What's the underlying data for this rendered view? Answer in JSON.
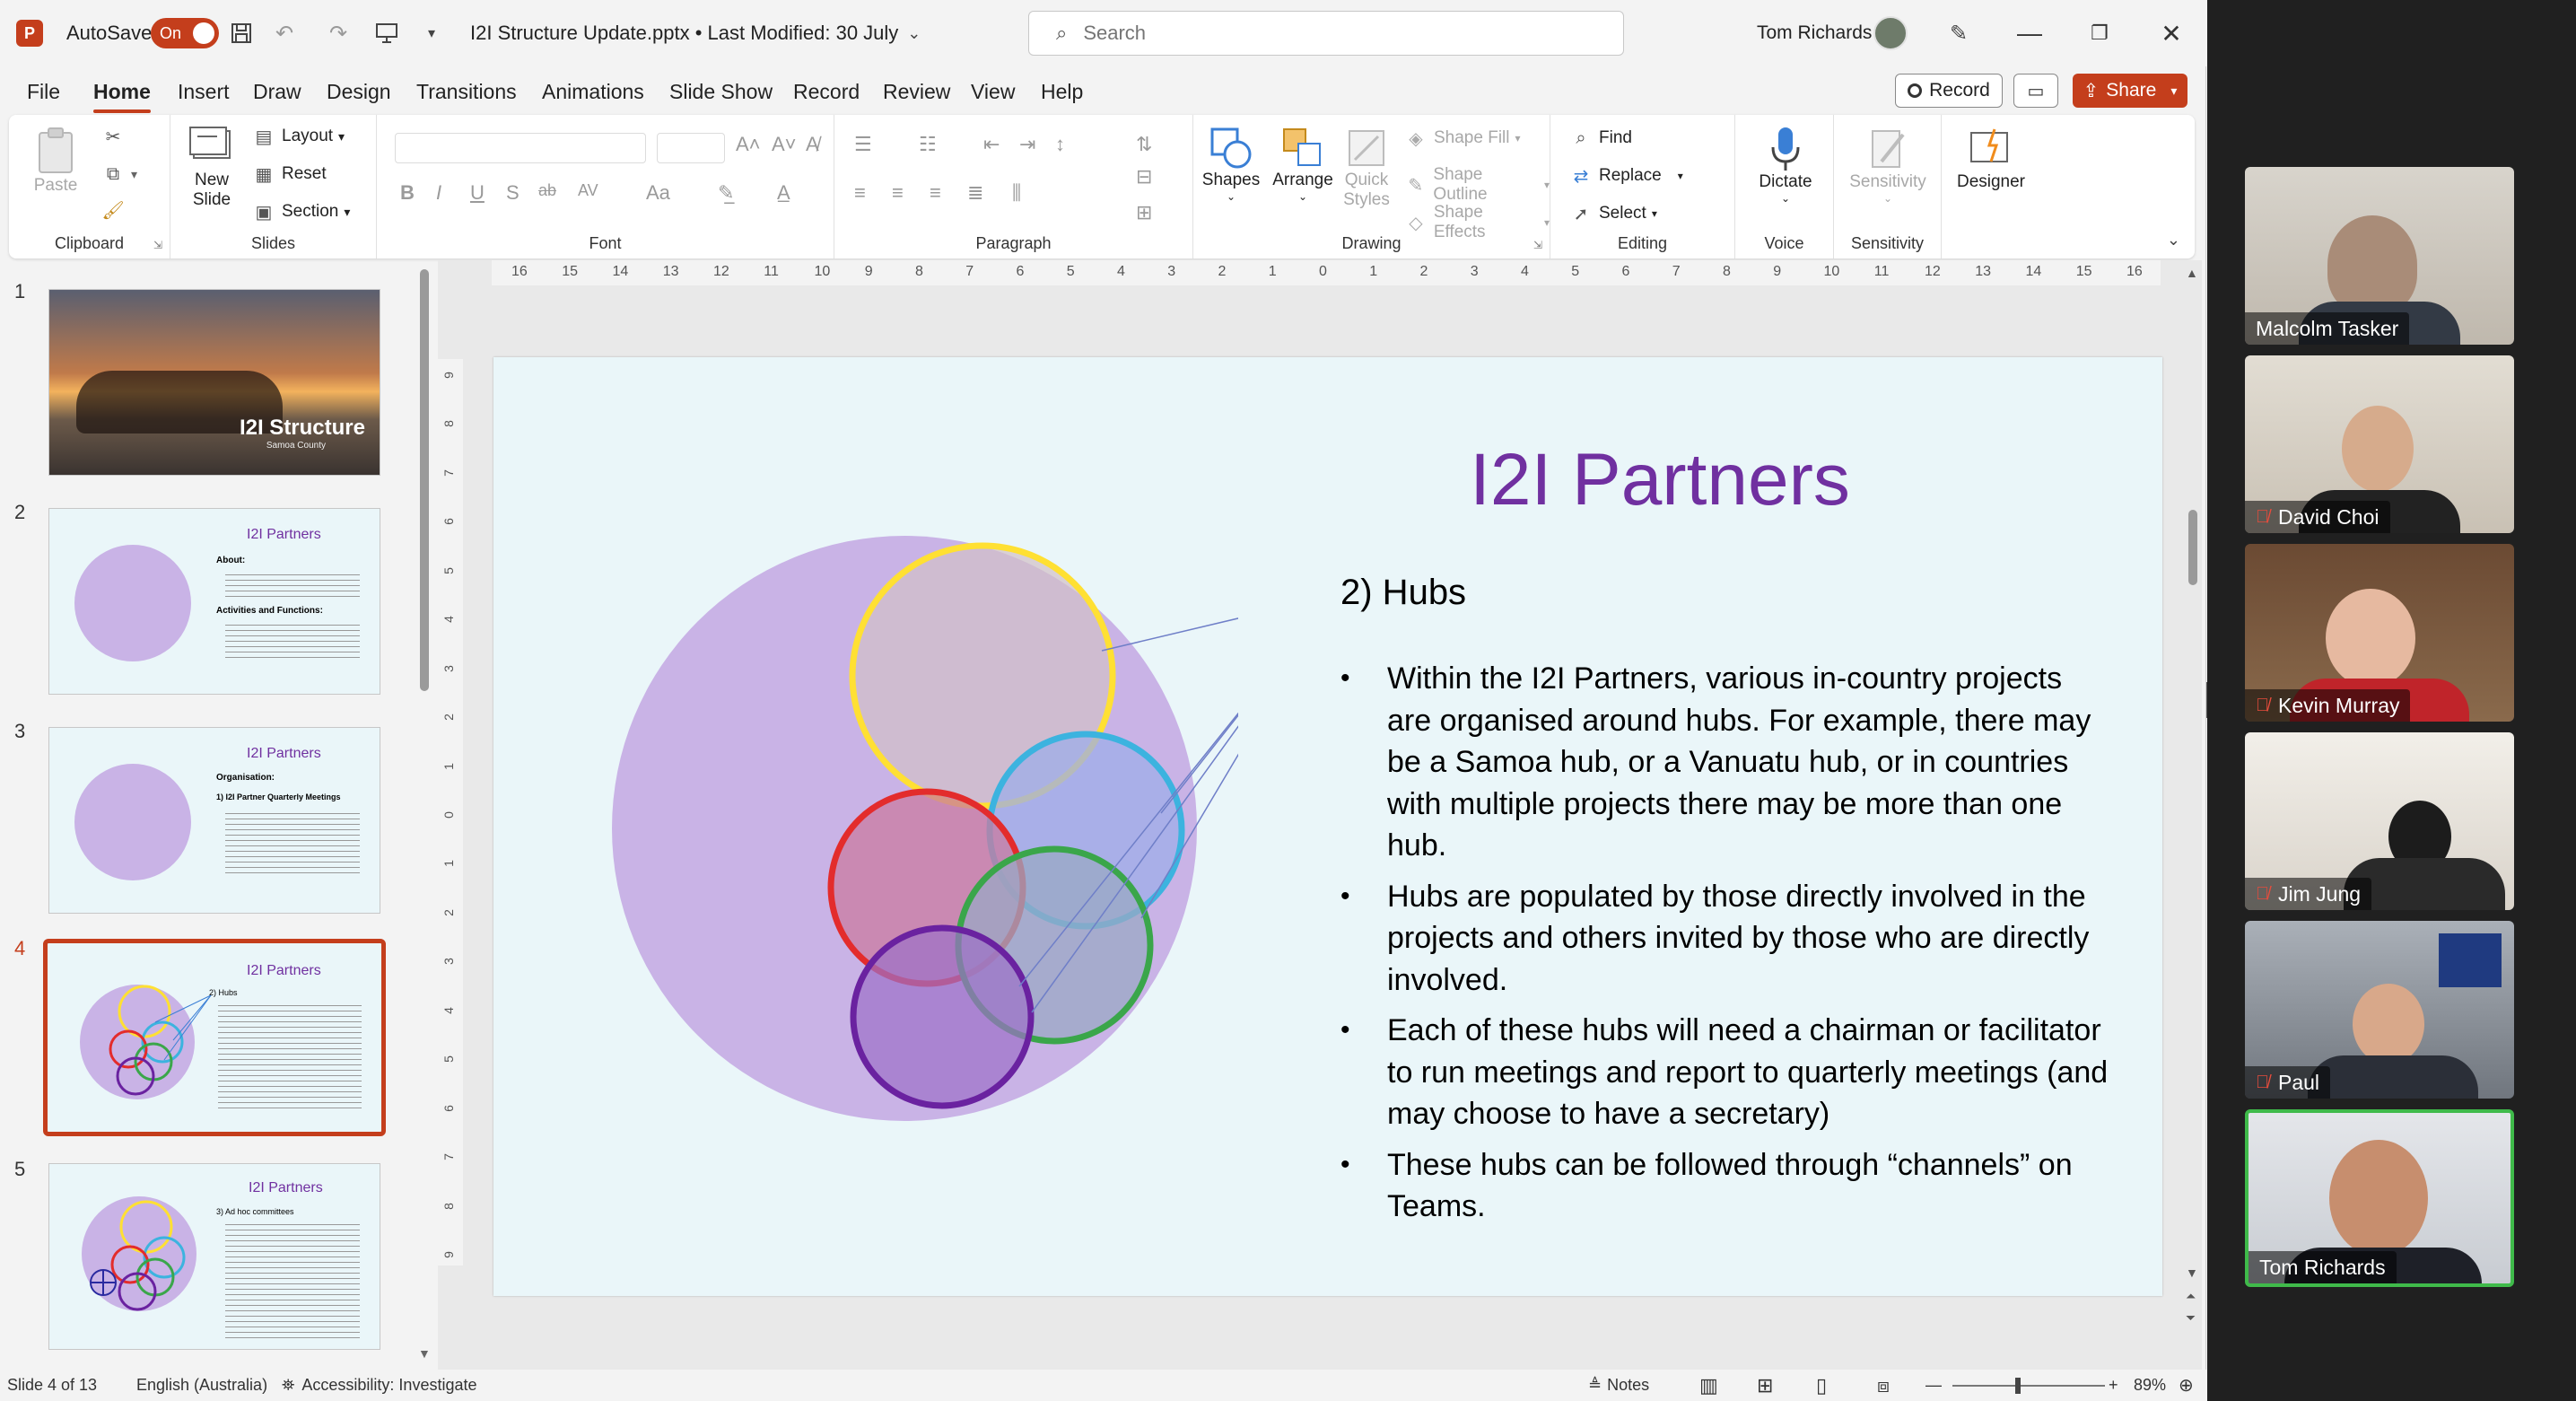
{
  "titlebar": {
    "app_logo": "P",
    "autosave_label": "AutoSave",
    "autosave_toggle": "On",
    "doc_title": "I2I Structure Update.pptx • Last Modified: 30 July",
    "search_placeholder": "Search",
    "user_name": "Tom Richards",
    "icons": [
      "save-icon",
      "undo-icon",
      "redo-icon",
      "present-icon",
      "customize-qat-icon",
      "pen-icon",
      "minimize-icon",
      "restore-icon",
      "close-icon"
    ]
  },
  "menu": {
    "tabs": [
      "File",
      "Home",
      "Insert",
      "Draw",
      "Design",
      "Transitions",
      "Animations",
      "Slide Show",
      "Record",
      "Review",
      "View",
      "Help"
    ],
    "active": "Home",
    "record_label": "Record",
    "share_label": "Share"
  },
  "ribbon": {
    "clipboard": {
      "label": "Clipboard",
      "paste": "Paste"
    },
    "slides": {
      "label": "Slides",
      "new_slide": "New Slide",
      "layout": "Layout",
      "reset": "Reset",
      "section": "Section"
    },
    "font": {
      "label": "Font"
    },
    "paragraph": {
      "label": "Paragraph"
    },
    "drawing": {
      "label": "Drawing",
      "shapes": "Shapes",
      "arrange": "Arrange",
      "quick_styles": "Quick Styles",
      "shape_fill": "Shape Fill",
      "shape_outline": "Shape Outline",
      "shape_effects": "Shape Effects"
    },
    "editing": {
      "label": "Editing",
      "find": "Find",
      "replace": "Replace",
      "select": "Select"
    },
    "voice": {
      "label": "Voice",
      "dictate": "Dictate"
    },
    "sensitivity": {
      "label": "Sensitivity",
      "sensitivity": "Sensitivity"
    },
    "designer": {
      "designer": "Designer"
    },
    "font_buttons": [
      "B",
      "I",
      "U",
      "S",
      "ab",
      "AV",
      "Aa"
    ]
  },
  "thumbnails": [
    {
      "number": "1",
      "title": "I2I Structure",
      "subtitle": "Samoa County"
    },
    {
      "number": "2",
      "title": "I2I Partners",
      "heading": "About:",
      "heading2": "Activities and Functions:"
    },
    {
      "number": "3",
      "title": "I2I Partners",
      "heading": "Organisation:",
      "heading2": "1) I2I Partner Quarterly Meetings"
    },
    {
      "number": "4",
      "title": "I2I Partners",
      "heading": "2) Hubs",
      "active": true
    },
    {
      "number": "5",
      "title": "I2I Partners",
      "heading": "3) Ad hoc committees"
    }
  ],
  "ruler": {
    "h": [
      "16",
      "15",
      "14",
      "13",
      "12",
      "11",
      "10",
      "9",
      "8",
      "7",
      "6",
      "5",
      "4",
      "3",
      "2",
      "1",
      "0",
      "1",
      "2",
      "3",
      "4",
      "5",
      "6",
      "7",
      "8",
      "9",
      "10",
      "11",
      "12",
      "13",
      "14",
      "15",
      "16"
    ],
    "v": [
      "9",
      "8",
      "7",
      "6",
      "5",
      "4",
      "3",
      "2",
      "1",
      "0",
      "1",
      "2",
      "3",
      "4",
      "5",
      "6",
      "7",
      "8",
      "9"
    ]
  },
  "slide": {
    "title": "I2I Partners",
    "subtitle": "2) Hubs",
    "bullets": [
      "Within the I2I Partners, various in-country projects are organised around hubs. For example, there may be a Samoa hub, or a Vanuatu hub, or in countries with multiple projects there may be more than one hub.",
      "Hubs are populated by those directly involved in the projects and others invited by those who are directly involved.",
      "Each of these hubs will need a chairman or facilitator to run meetings and report to quarterly meetings (and may choose to have a secretary)",
      "These hubs can be followed through “channels” on Teams."
    ],
    "colors": {
      "title": "#7030a0",
      "big_circle": "#c9b3e6",
      "yellow": "#ffe033",
      "cyan": "#3cb3df",
      "red": "#e32c2c",
      "green": "#3aa64a",
      "purple": "#6a22a0",
      "slide_bg": "#eaf6f9"
    }
  },
  "statusbar": {
    "slide_of": "Slide 4 of 13",
    "language": "English (Australia)",
    "accessibility": "Accessibility: Investigate",
    "notes": "Notes",
    "zoom": "89%"
  },
  "participants": [
    {
      "name": "Malcolm Tasker",
      "muted": false,
      "speaking": false
    },
    {
      "name": "David Choi",
      "muted": true,
      "speaking": false
    },
    {
      "name": "Kevin Murray",
      "muted": true,
      "speaking": false
    },
    {
      "name": "Jim Jung",
      "muted": true,
      "speaking": false
    },
    {
      "name": "Paul",
      "muted": true,
      "speaking": false
    },
    {
      "name": "Tom Richards",
      "muted": false,
      "speaking": true
    }
  ]
}
